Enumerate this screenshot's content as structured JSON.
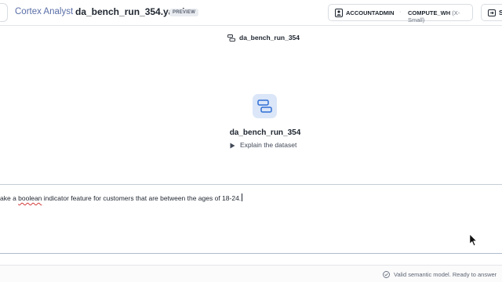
{
  "header": {
    "app_title": "Cortex Analyst",
    "file_name": "da_bench_run_354.yaml",
    "badge": "PREVIEW",
    "role": "ACCOUNTADMIN",
    "separator": "·",
    "warehouse": "COMPUTE_WH",
    "warehouse_size": "(X-Small)",
    "share_label": "S"
  },
  "model_chip": {
    "label": "da_bench_run_354"
  },
  "welcome": {
    "title": "da_bench_run_354",
    "explain_label": "Explain the dataset"
  },
  "composer": {
    "text_prefix": "ake a ",
    "text_misspelled": "boolean",
    "text_suffix": " indicator feature for customers that are between the ages of 18-24."
  },
  "footer": {
    "status": "Valid semantic model. Ready to answer"
  },
  "colors": {
    "accent": "#2f6fd6",
    "tile_bg": "#dbe6f8",
    "app_title": "#5a6ea8",
    "spellcheck": "#d23a3a"
  },
  "icons": {
    "role": "user-badge-icon",
    "share": "share-icon",
    "model": "semantic-model-icon",
    "tile": "model-stack-icon",
    "explain": "play-triangle-icon",
    "status": "check-circle-icon",
    "cursor": "mouse-cursor-icon"
  }
}
